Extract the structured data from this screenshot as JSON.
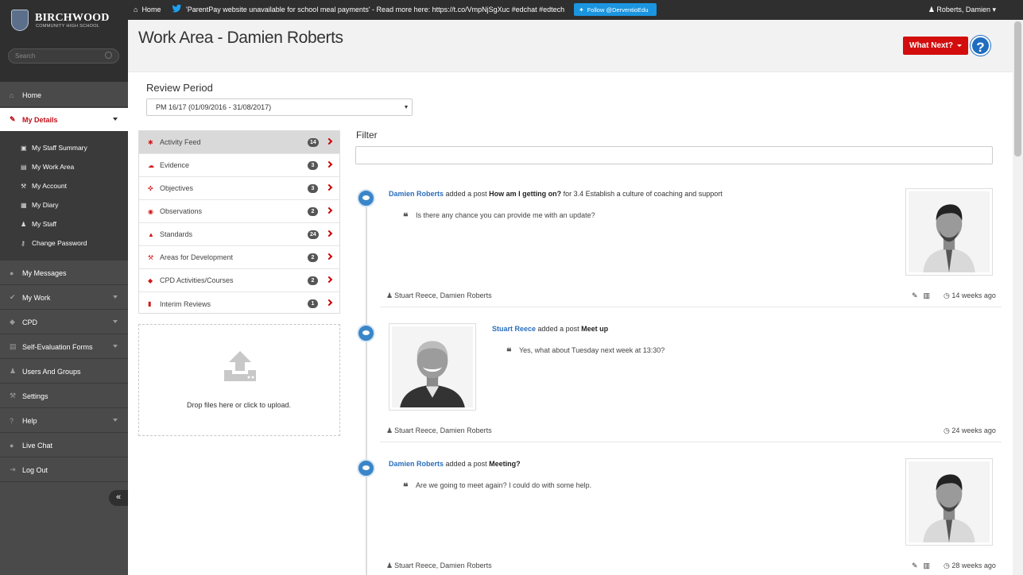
{
  "topbar": {
    "school_name": "BIRCHWOOD",
    "school_sub": "COMMUNITY HIGH SCHOOL",
    "home_label": "Home",
    "tweet": "'ParentPay website unavailable for school meal payments' - Read more here: https://t.co/VmpNjSgXuc #edchat #edtech",
    "follow_label": "Follow @DerventioEdu",
    "user_label": "Roberts, Damien"
  },
  "sidebar": {
    "search_placeholder": "Search",
    "items": [
      {
        "label": "Home",
        "icon": "home-icon"
      },
      {
        "label": "My Details",
        "icon": "pencil-icon"
      },
      {
        "label": "My Messages",
        "icon": "chat-icon"
      },
      {
        "label": "My Work",
        "icon": "check-icon"
      },
      {
        "label": "CPD",
        "icon": "tag-icon"
      },
      {
        "label": "Self-Evaluation Forms",
        "icon": "form-icon"
      },
      {
        "label": "Users And Groups",
        "icon": "users-icon"
      },
      {
        "label": "Settings",
        "icon": "wrench-icon"
      },
      {
        "label": "Help",
        "icon": "question-icon"
      },
      {
        "label": "Live Chat",
        "icon": "chat-icon"
      },
      {
        "label": "Log Out",
        "icon": "logout-icon"
      }
    ],
    "subitems": [
      {
        "label": "My Staff Summary",
        "icon": "id-card-icon"
      },
      {
        "label": "My Work Area",
        "icon": "briefcase-icon"
      },
      {
        "label": "My Account",
        "icon": "wrench-icon"
      },
      {
        "label": "My Diary",
        "icon": "calendar-icon"
      },
      {
        "label": "My Staff",
        "icon": "users-icon"
      },
      {
        "label": "Change Password",
        "icon": "key-icon"
      }
    ]
  },
  "header": {
    "title": "Work Area - Damien Roberts",
    "what_next_label": "What Next?",
    "help_label": "?"
  },
  "review_period": {
    "label": "Review Period",
    "selected": "PM 16/17 (01/09/2016 - 31/08/2017)"
  },
  "categories": [
    {
      "label": "Activity Feed",
      "count": "14",
      "icon": "asterisk-icon"
    },
    {
      "label": "Evidence",
      "count": "3",
      "icon": "cloud-upload-icon"
    },
    {
      "label": "Objectives",
      "count": "3",
      "icon": "crosshairs-icon"
    },
    {
      "label": "Observations",
      "count": "2",
      "icon": "eye-icon"
    },
    {
      "label": "Standards",
      "count": "24",
      "icon": "thumbs-up-icon"
    },
    {
      "label": "Areas for Development",
      "count": "2",
      "icon": "gavel-icon"
    },
    {
      "label": "CPD Activities/Courses",
      "count": "2",
      "icon": "tags-icon"
    },
    {
      "label": "Interim Reviews",
      "count": "1",
      "icon": "bar-chart-icon"
    }
  ],
  "upload": {
    "text": "Drop files here or click to upload."
  },
  "filter": {
    "label": "Filter",
    "value": ""
  },
  "feed": [
    {
      "author": "Damien Roberts",
      "action": "added a post",
      "title": "How am I getting on?",
      "suffix": "for 3.4 Establish a culture of coaching and support",
      "quote": "Is there any chance you can provide me with an update?",
      "participants": "Stuart Reece, Damien Roberts",
      "time": "14 weeks ago"
    },
    {
      "author": "Stuart Reece",
      "action": "added a post",
      "title": "Meet up",
      "suffix": "",
      "quote": "Yes, what about Tuesday next week at 13:30?",
      "participants": "Stuart Reece, Damien Roberts",
      "time": "24 weeks ago"
    },
    {
      "author": "Damien Roberts",
      "action": "added a post",
      "title": "Meeting?",
      "suffix": "",
      "quote": "Are we going to meet again? I could do with some help.",
      "participants": "Stuart Reece, Damien Roberts",
      "time": "28 weeks ago"
    }
  ],
  "colors": {
    "accent_red": "#d30d0d",
    "link_blue": "#2a6ebb",
    "timeline_blue": "#3a86c8",
    "sidebar_bg": "#4a4a4a"
  }
}
